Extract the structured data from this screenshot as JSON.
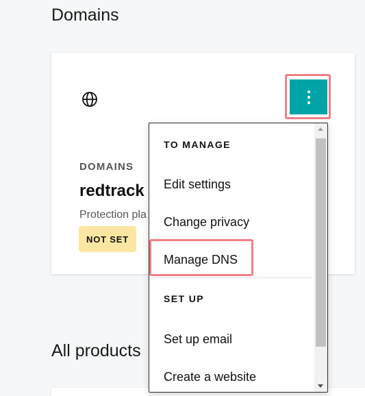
{
  "page": {
    "title": "Domains",
    "all_products_title": "All products"
  },
  "domain_card": {
    "eyebrow": "DOMAINS",
    "domain_name": "redtrack",
    "protection_text": "Protection pla",
    "status_badge": "NOT SET",
    "globe_icon": "globe-icon",
    "more_icon": "more-vertical-icon",
    "accent_color": "#00a4a6",
    "badge_color": "#fbe7a1",
    "highlight_color": "#f07e84"
  },
  "menu": {
    "manage_heading": "TO MANAGE",
    "edit_settings": "Edit settings",
    "change_privacy": "Change privacy",
    "manage_dns": "Manage DNS",
    "setup_heading": "SET UP",
    "setup_email": "Set up email",
    "create_website": "Create a website"
  }
}
